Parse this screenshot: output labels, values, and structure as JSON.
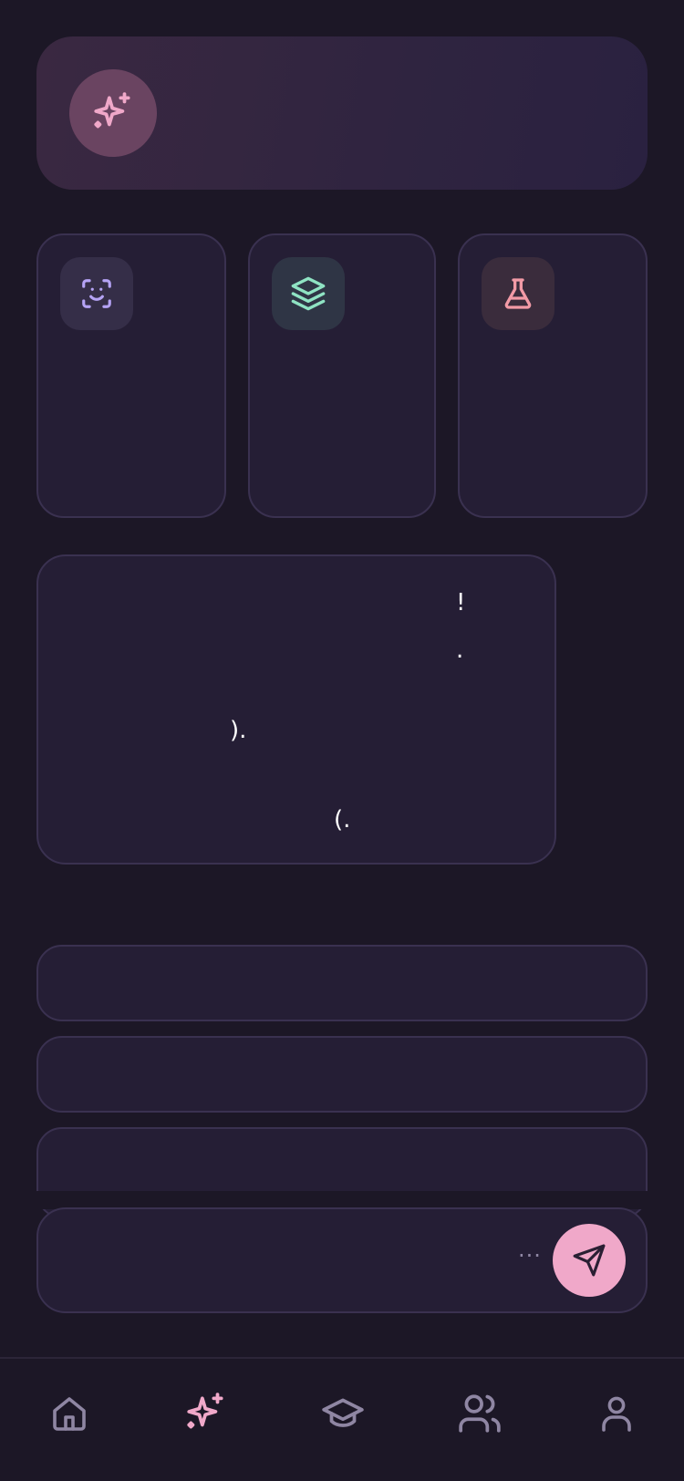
{
  "colors": {
    "background": "#1c1726",
    "card": "#251e35",
    "accent_pink": "#f0a8c9",
    "accent_purple": "#b5a3f5",
    "accent_green": "#8fe3c3",
    "accent_red": "#f29aa6",
    "muted": "#8f86a3"
  },
  "hero": {
    "icon": "sparkles-icon"
  },
  "cards": [
    {
      "icon": "face-scan-icon"
    },
    {
      "icon": "layers-icon"
    },
    {
      "icon": "flask-icon"
    }
  ],
  "message": {
    "glyphs": [
      "!",
      ".",
      ").",
      "(."
    ]
  },
  "composer": {
    "typing_indicator": "..."
  },
  "tabbar": {
    "items": [
      {
        "icon": "home-icon"
      },
      {
        "icon": "sparkles-icon",
        "active": true
      },
      {
        "icon": "graduation-cap-icon"
      },
      {
        "icon": "users-icon"
      },
      {
        "icon": "user-icon"
      }
    ]
  }
}
